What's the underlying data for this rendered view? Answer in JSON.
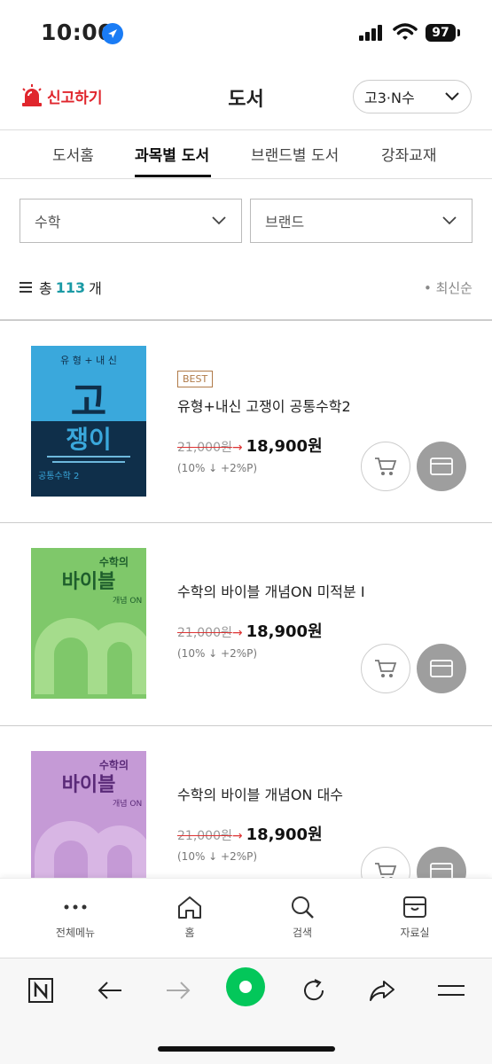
{
  "status": {
    "time": "10:00",
    "battery": "97"
  },
  "header": {
    "report_label": "신고하기",
    "title": "도서",
    "grade": "고3·N수"
  },
  "tabs": [
    "도서홈",
    "과목별 도서",
    "브랜드별 도서",
    "강좌교재"
  ],
  "filters": {
    "subject": "수학",
    "brand": "브랜드"
  },
  "list": {
    "total_prefix": "총",
    "total": "113",
    "total_suffix": "개",
    "sort": "• 최신순"
  },
  "books": [
    {
      "badge": "BEST",
      "title": "유형+내신 고쟁이 공통수학2",
      "original_price": "21,000원",
      "sale_price": "18,900원",
      "discount": "(10% ↓ +2%P)",
      "cover": {
        "top_text": "유 형 + 내 신",
        "main1": "고",
        "main2": "쟁이",
        "sub": "공통수학 2",
        "bg_top": "#3aa8dc",
        "bg_bottom": "#0f2f4a"
      }
    },
    {
      "badge": "",
      "title": "수학의 바이블 개념ON 미적분 Ⅰ",
      "original_price": "21,000원",
      "sale_price": "18,900원",
      "discount": "(10% ↓ +2%P)",
      "cover": {
        "top_text": "수학의",
        "main1": "바이블",
        "sub": "개념 ON",
        "bg": "#7fc86a"
      }
    },
    {
      "badge": "",
      "title": "수학의 바이블 개념ON 대수",
      "original_price": "21,000원",
      "sale_price": "18,900원",
      "discount": "(10% ↓ +2%P)",
      "cover": {
        "top_text": "수학의",
        "main1": "바이블",
        "sub": "개념 ON",
        "bg": "#c59ad6"
      }
    }
  ],
  "app_nav": [
    "전체메뉴",
    "홈",
    "검색",
    "자료실"
  ],
  "colors": {
    "accent_teal": "#1a9aa5",
    "report_red": "#e0262d",
    "naver_green": "#03c75a"
  }
}
